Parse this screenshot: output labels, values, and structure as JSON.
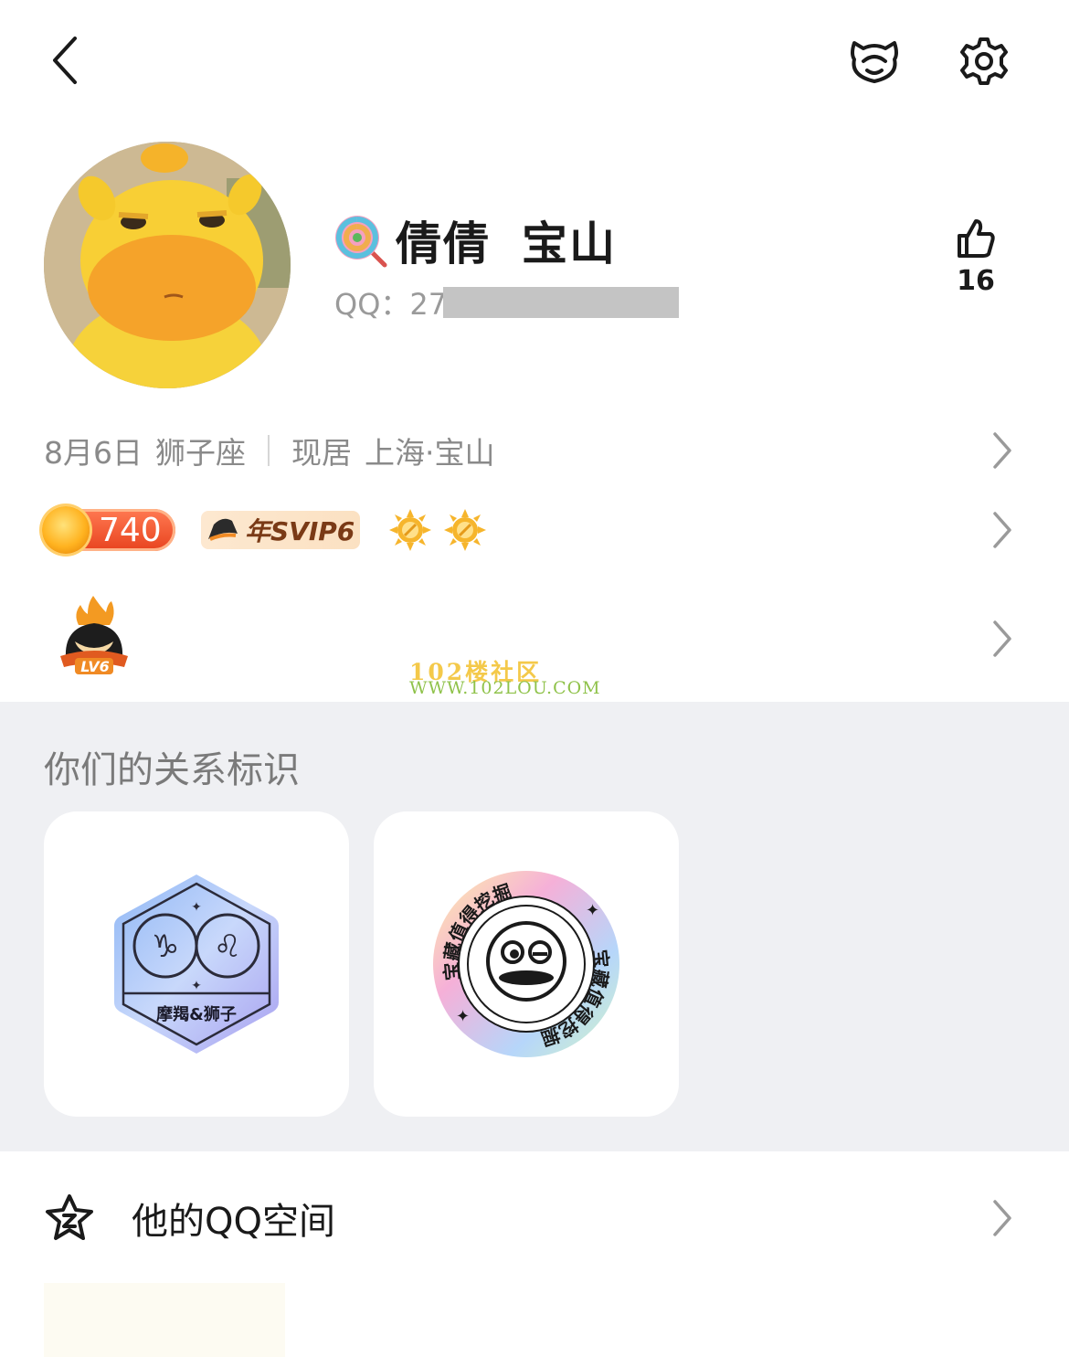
{
  "top_bar": {
    "back_icon": "chevron-left-icon",
    "pet_icon": "pet-face-icon",
    "settings_icon": "gear-icon"
  },
  "profile": {
    "emoji_icon": "lollipop-icon",
    "nickname": "倩倩",
    "nickname_suffix": "宝山",
    "qq_label": "QQ：27",
    "qq_masked": true,
    "like_icon": "thumbs-up-icon",
    "like_count": "16"
  },
  "info": {
    "birthday": "8月6日",
    "zodiac": "狮子座",
    "location_label": "现居",
    "location": "上海·宝山"
  },
  "badges": {
    "coin_value": "740",
    "svip_label": "年SVIP6",
    "sun_count": 2
  },
  "level_badge": {
    "label": "LV6"
  },
  "watermark": {
    "title": "102楼社区",
    "url": "WWW.102LOU.COM"
  },
  "relation": {
    "title": "你们的关系标识",
    "cards": [
      {
        "label": "摩羯&狮子",
        "icon": "capricorn-leo-hexagon-badge"
      },
      {
        "label": "宝藏值得挖掘",
        "icon": "treasure-circle-badge"
      }
    ]
  },
  "space": {
    "icon": "qzone-star-icon",
    "label": "他的QQ空间"
  },
  "colors": {
    "background": "#ffffff",
    "section_gray": "#eff0f3",
    "muted_text": "#8a8a8a",
    "coin_red": "#e8431f",
    "svip_brown": "#7a3a16"
  }
}
